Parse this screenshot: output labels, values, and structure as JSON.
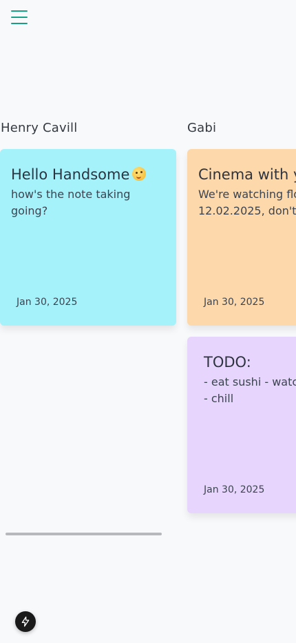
{
  "header": {
    "menu_icon": "hamburger-menu-icon",
    "accent_color": "#16a085"
  },
  "board": {
    "columns": [
      {
        "title": "Henry Cavill",
        "notes": [
          {
            "title": "Hello Handsome",
            "emoji": "smiling-face-emoji",
            "body": "how's the note taking going?",
            "date": "Jan 30, 2025",
            "color": "#a5f2fb"
          }
        ]
      },
      {
        "title": "Gabi",
        "notes": [
          {
            "title": "Cinema with y",
            "body": "We're watching flo\n12.02.2025, don't fo",
            "date": "Jan 30, 2025",
            "color": "#fdd8ab"
          },
          {
            "title": "TODO:",
            "body": "- eat sushi - watc\n- chill",
            "date": "Jan 30, 2025",
            "color": "#e8d5fd"
          }
        ]
      }
    ]
  },
  "dev_badge": {
    "icon": "lightning-bolt-icon"
  }
}
